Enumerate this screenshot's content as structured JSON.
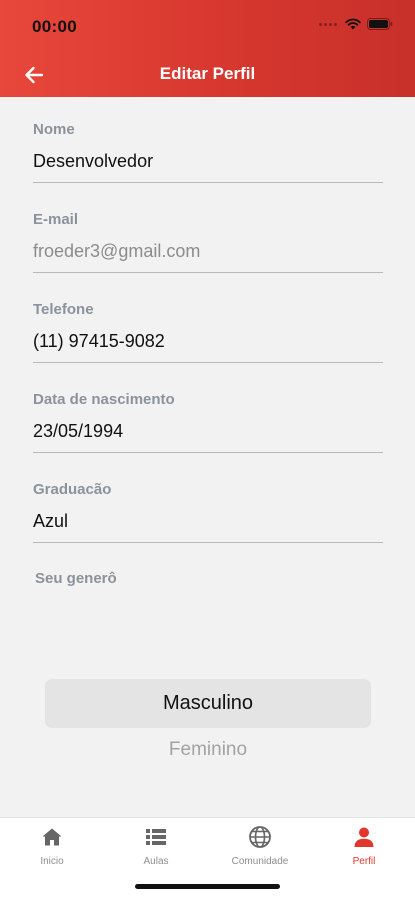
{
  "status_bar": {
    "time": "00:00"
  },
  "header": {
    "title": "Editar Perfil"
  },
  "form": {
    "fields": [
      {
        "label": "Nome",
        "value": "Desenvolvedor"
      },
      {
        "label": "E-mail",
        "value": "froeder3@gmail.com"
      },
      {
        "label": "Telefone",
        "value": "(11) 97415-9082"
      },
      {
        "label": "Data de nascimento",
        "value": "23/05/1994"
      },
      {
        "label": "Graduacão",
        "value": "Azul"
      }
    ]
  },
  "gender": {
    "label": "Seu generô",
    "selected": "Masculino",
    "options": [
      "Masculino",
      "Feminino"
    ],
    "option_below": "Feminino"
  },
  "tabbar": {
    "tabs": [
      {
        "label": "Inicio",
        "icon": "home-icon"
      },
      {
        "label": "Aulas",
        "icon": "list-icon"
      },
      {
        "label": "Comunidade",
        "icon": "globe-icon"
      },
      {
        "label": "Perfil",
        "icon": "user-icon"
      }
    ],
    "active": "Perfil"
  },
  "colors": {
    "header_start": "#e8473b",
    "header_end": "#c8302a",
    "accent": "#e0362c",
    "background": "#f2f2f2"
  }
}
